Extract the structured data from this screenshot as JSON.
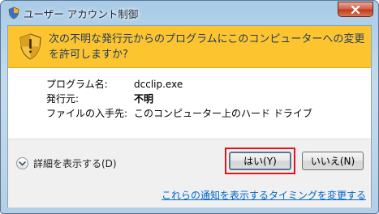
{
  "window": {
    "title": "ユーザー アカウント制御"
  },
  "header": {
    "message": "次の不明な発行元からのプログラムにこのコンピューターへの変更を許可しますか?"
  },
  "details": {
    "program_label": "プログラム名:",
    "program_value": "dcclip.exe",
    "publisher_label": "発行元:",
    "publisher_value": "不明",
    "origin_label": "ファイルの入手先:",
    "origin_value": "このコンピューター上のハード ドライブ"
  },
  "footer": {
    "show_details_label": "詳細を表示する(D)",
    "yes_label": "はい(Y)",
    "no_label": "いいえ(N)",
    "notify_link": "これらの通知を表示するタイミングを変更する"
  },
  "colors": {
    "header_bg": "#fcc530",
    "highlight": "#e0141e",
    "link": "#0066cc"
  },
  "icons": [
    "uac-shield-icon",
    "close-icon",
    "expand-chevron-icon"
  ]
}
